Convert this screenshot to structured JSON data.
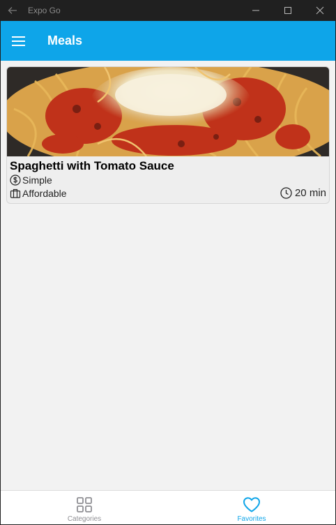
{
  "window": {
    "app_title": "Expo Go"
  },
  "header": {
    "title": "Meals"
  },
  "meals": [
    {
      "title": "Spaghetti with Tomato Sauce",
      "complexity": "Simple",
      "affordability": "Affordable",
      "duration": "20 min"
    }
  ],
  "tabs": [
    {
      "label": "Categories",
      "icon": "grid-icon",
      "active": false
    },
    {
      "label": "Favorites",
      "icon": "heart-icon",
      "active": true
    }
  ],
  "colors": {
    "accent": "#0ea5e9",
    "titlebar": "#202020",
    "background": "#f2f2f2"
  }
}
